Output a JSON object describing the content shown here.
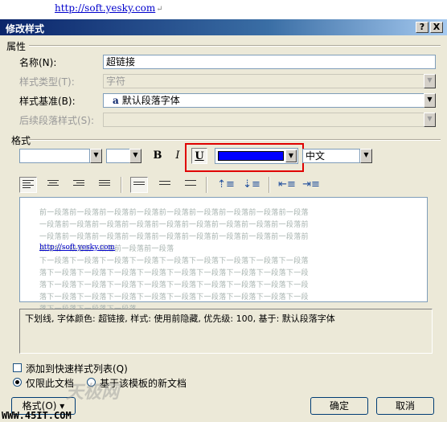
{
  "document": {
    "link_text": "http://soft.yesky.com",
    "para_mark": "↵"
  },
  "dialog": {
    "title": "修改样式",
    "help_btn": "?",
    "close_btn": "X"
  },
  "properties": {
    "section": "属性",
    "name_label": "名称(N):",
    "name_value": "超链接",
    "type_label": "样式类型(T):",
    "type_value": "字符",
    "base_label": "样式基准(B):",
    "base_icon": "a",
    "base_value": "默认段落字体",
    "next_label": "后续段落样式(S):",
    "next_value": ""
  },
  "format": {
    "section": "格式",
    "font_value": "",
    "size_value": "",
    "bold": "B",
    "italic": "I",
    "underline": "U",
    "font_color": "#0000ff",
    "lang_value": "中文"
  },
  "preview": {
    "prev_para": [
      "前一段落前一段落前一段落前一段落前一段落前一段落前一段落前一段落前一段落",
      "一段落前一段落前一段落前一段落前一段落前一段落前一段落前一段落前一段落前",
      "一段落前一段落前一段落前一段落前一段落前一段落前一段落前一段落前一段落前",
      "段落前一段落前一段落前一段落前一段落"
    ],
    "sample": "http://soft.yesky.com",
    "next_para": [
      "下一段落下一段落下一段落下一段落下一段落下一段落下一段落下一段落下一段落",
      "落下一段落下一段落下一段落下一段落下一段落下一段落下一段落下一段落下一段",
      "落下一段落下一段落下一段落下一段落下一段落下一段落下一段落下一段落下一段",
      "落下一段落下一段落下一段落下一段落下一段落下一段落下一段落下一段落下一段",
      "落下一段落下一段落下一段落"
    ]
  },
  "description": "下划线, 字体颜色: 超链接, 样式: 使用前隐藏, 优先级: 100, 基于: 默认段落字体",
  "options": {
    "add_quick": "添加到快速样式列表(Q)",
    "only_doc": "仅限此文档",
    "new_docs": "基于该模板的新文档"
  },
  "buttons": {
    "format": "格式(O) ▾",
    "ok": "确定",
    "cancel": "取消"
  },
  "watermark": {
    "site": "WWW.45IT.COM",
    "brand": "天极网"
  },
  "colors": {
    "highlight": "#e00000",
    "dialog_bg": "#ece9d8",
    "title_bar": "#0a246a"
  }
}
